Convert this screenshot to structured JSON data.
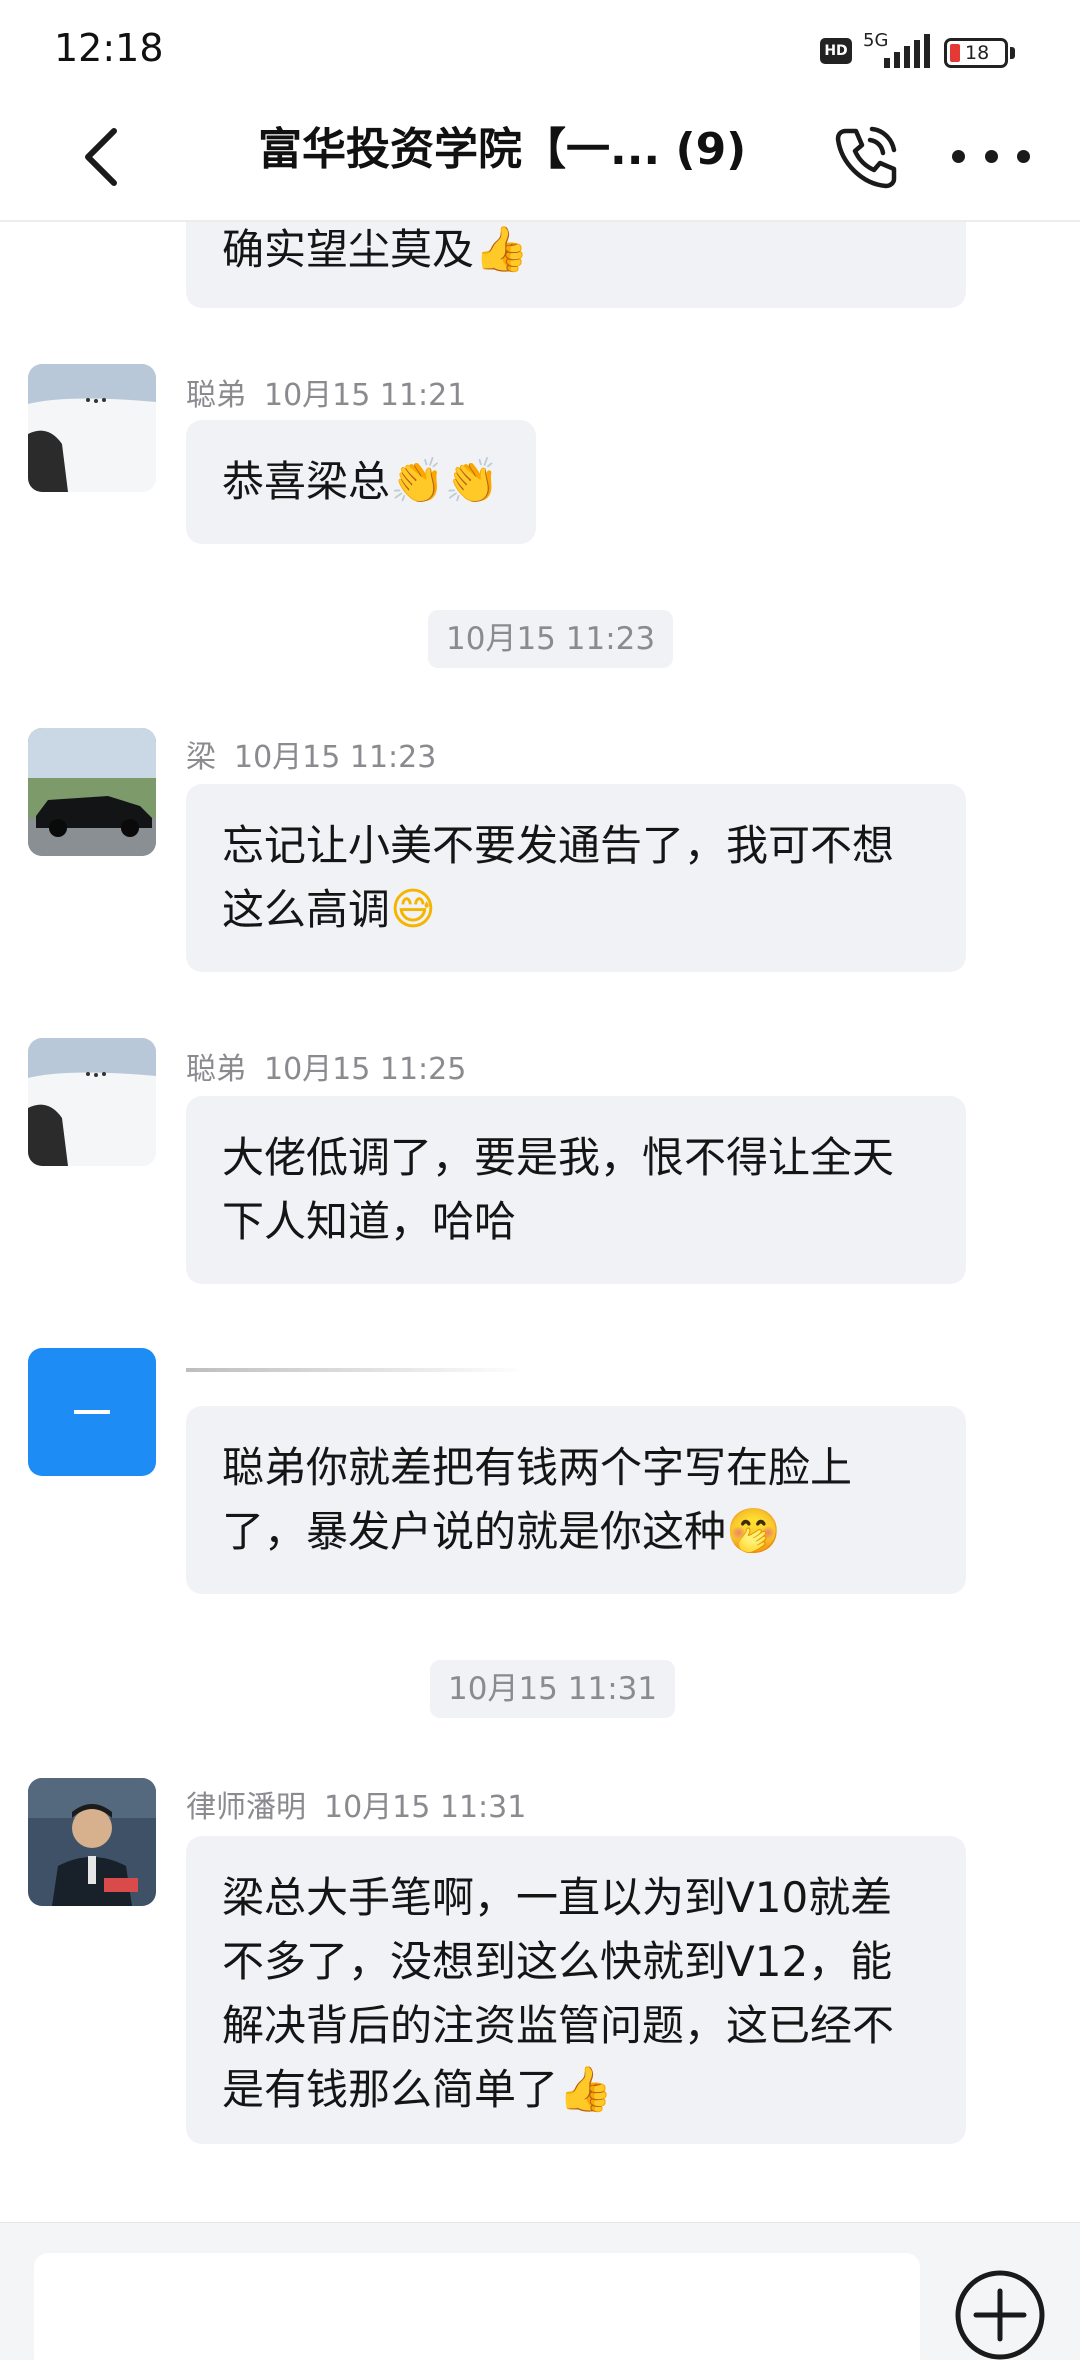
{
  "status_bar": {
    "time": "12:18",
    "hd": "HD",
    "network": "5G",
    "battery": "18"
  },
  "header": {
    "title": "富华投资学院【一... (9)",
    "icons": [
      "back-arrow-icon",
      "phone-icon",
      "more-dots-icon"
    ]
  },
  "messages": [
    {
      "id": "m0",
      "sender": "",
      "time": "",
      "text": "确实望尘莫及",
      "emoji": "👍"
    },
    {
      "id": "m1",
      "sender": "聪弟",
      "time": "10月15 11:21",
      "text": "恭喜梁总",
      "emoji": "👏👏"
    },
    {
      "id": "m2",
      "sender": "梁",
      "time": "10月15 11:23",
      "text": "忘记让小美不要发通告了，我可不想这么高调",
      "emoji": "😅"
    },
    {
      "id": "m3",
      "sender": "聪弟",
      "time": "10月15 11:25",
      "text": "大佬低调了，要是我，恨不得让全天下人知道，哈哈",
      "emoji": ""
    },
    {
      "id": "m4",
      "sender": "",
      "time": "",
      "text": "聪弟你就差把有钱两个字写在脸上了，暴发户说的就是你这种",
      "emoji": "🤭"
    },
    {
      "id": "m5",
      "sender": "律师潘明",
      "time": "10月15 11:31",
      "text": "梁总大手笔啊，一直以为到V10就差不多了，没想到这么快就到V12，能解决背后的注资监管问题，这已经不是有钱那么简单了",
      "emoji": "👍"
    }
  ],
  "timestamps": [
    "10月15 11:23",
    "10月15 11:31"
  ],
  "composer": {
    "value": "",
    "placeholder": ""
  },
  "colors": {
    "bubble": "#f1f2f5",
    "meta": "#8a8a8f",
    "blue_avatar": "#1e8cf5"
  }
}
